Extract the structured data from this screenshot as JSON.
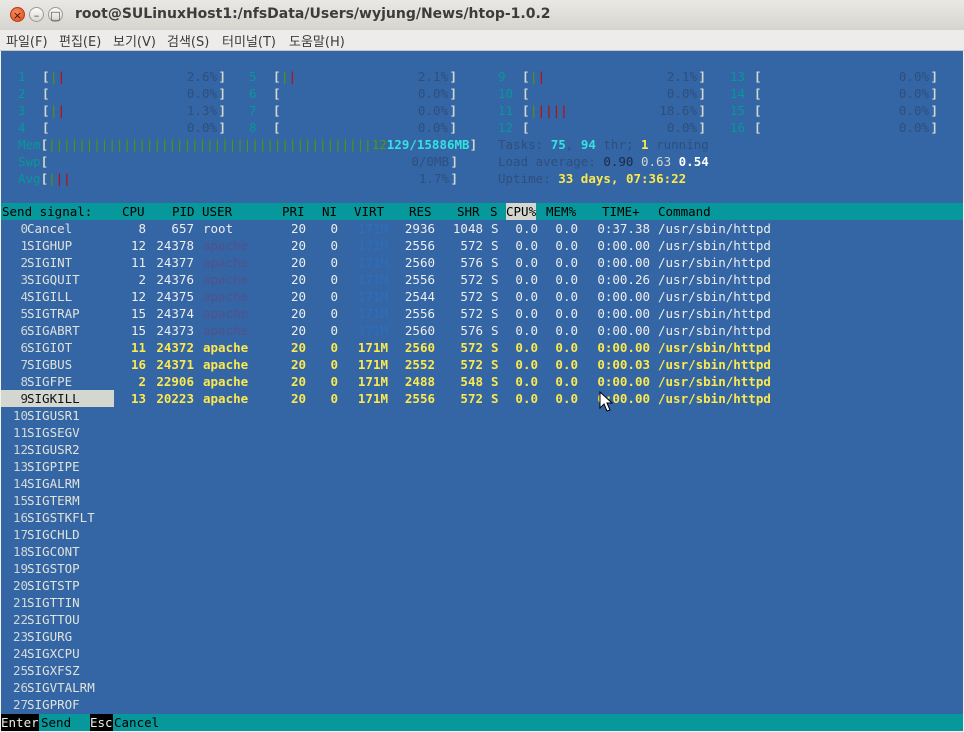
{
  "window": {
    "title": "root@SULinuxHost1:/nfsData/Users/wyjung/News/htop-1.0.2"
  },
  "menu": [
    "파일(F)",
    "편집(E)",
    "보기(V)",
    "검색(S)",
    "터미널(T)",
    "도움말(H)"
  ],
  "cpus": [
    {
      "id": "1",
      "bar": "||",
      "pct": "2.6%"
    },
    {
      "id": "2",
      "bar": "",
      "pct": "0.0%"
    },
    {
      "id": "3",
      "bar": "||",
      "pct": "1.3%"
    },
    {
      "id": "4",
      "bar": "",
      "pct": "0.0%"
    },
    {
      "id": "5",
      "bar": "||",
      "pct": "2.1%"
    },
    {
      "id": "6",
      "bar": "",
      "pct": "0.0%"
    },
    {
      "id": "7",
      "bar": "",
      "pct": "0.0%"
    },
    {
      "id": "8",
      "bar": "",
      "pct": "0.0%"
    },
    {
      "id": "9",
      "bar": "||",
      "pct": "2.1%"
    },
    {
      "id": "10",
      "bar": "",
      "pct": "0.0%"
    },
    {
      "id": "11",
      "bar": "|||||",
      "pct": "18.6%"
    },
    {
      "id": "12",
      "bar": "",
      "pct": "0.0%"
    },
    {
      "id": "13",
      "bar": "",
      "pct": "0.0%"
    },
    {
      "id": "14",
      "bar": "",
      "pct": "0.0%"
    },
    {
      "id": "15",
      "bar": "",
      "pct": "0.0%"
    },
    {
      "id": "16",
      "bar": "",
      "pct": "0.0%"
    }
  ],
  "meters": {
    "mem_label": "Mem",
    "mem_bar": "|||||||||||||||||||||||||||||||||||||||||||12",
    "mem_value": "129/15886MB",
    "swp_label": "Swp",
    "swp_value": "0/0MB",
    "avg_label": "Avg",
    "avg_value": "1.7%"
  },
  "tasks": {
    "label": "Tasks: ",
    "count": "75",
    "thr": "94",
    "thr_label": " thr; ",
    "running": "1",
    "running_label": " running",
    "load_label": "Load average: ",
    "load1": "0.90",
    "load5": "0.63",
    "load15": "0.54",
    "uptime_label": "Uptime: ",
    "days": "33",
    "days_label": " days",
    "time": "07:36:22"
  },
  "header": {
    "send_signal": "Send signal:",
    "cols": [
      "CPU",
      "PID",
      "USER",
      "PRI",
      "NI",
      "VIRT",
      "RES",
      "SHR",
      "S",
      "CPU%",
      "MEM%",
      "TIME+",
      "Command"
    ]
  },
  "signals": [
    {
      "n": "0",
      "name": "Cancel"
    },
    {
      "n": "1",
      "name": "SIGHUP"
    },
    {
      "n": "2",
      "name": "SIGINT"
    },
    {
      "n": "3",
      "name": "SIGQUIT"
    },
    {
      "n": "4",
      "name": "SIGILL"
    },
    {
      "n": "5",
      "name": "SIGTRAP"
    },
    {
      "n": "6",
      "name": "SIGABRT"
    },
    {
      "n": "6",
      "name": "SIGIOT"
    },
    {
      "n": "7",
      "name": "SIGBUS"
    },
    {
      "n": "8",
      "name": "SIGFPE"
    },
    {
      "n": "9",
      "name": "SIGKILL"
    },
    {
      "n": "10",
      "name": "SIGUSR1"
    },
    {
      "n": "11",
      "name": "SIGSEGV"
    },
    {
      "n": "12",
      "name": "SIGUSR2"
    },
    {
      "n": "13",
      "name": "SIGPIPE"
    },
    {
      "n": "14",
      "name": "SIGALRM"
    },
    {
      "n": "15",
      "name": "SIGTERM"
    },
    {
      "n": "16",
      "name": "SIGSTKFLT"
    },
    {
      "n": "17",
      "name": "SIGCHLD"
    },
    {
      "n": "18",
      "name": "SIGCONT"
    },
    {
      "n": "19",
      "name": "SIGSTOP"
    },
    {
      "n": "20",
      "name": "SIGTSTP"
    },
    {
      "n": "21",
      "name": "SIGTTIN"
    },
    {
      "n": "22",
      "name": "SIGTTOU"
    },
    {
      "n": "23",
      "name": "SIGURG"
    },
    {
      "n": "24",
      "name": "SIGXCPU"
    },
    {
      "n": "25",
      "name": "SIGXFSZ"
    },
    {
      "n": "26",
      "name": "SIGVTALRM"
    },
    {
      "n": "27",
      "name": "SIGPROF"
    }
  ],
  "selected_signal": "9",
  "processes": [
    {
      "cpu": "8",
      "pid": "657",
      "user": "root",
      "pri": "20",
      "ni": "0",
      "virt": "171M",
      "res": "2936",
      "shr": "1048",
      "s": "S",
      "cpup": "0.0",
      "memp": "0.0",
      "time": "0:37.38",
      "cmd": "/usr/sbin/httpd",
      "style": "normal"
    },
    {
      "cpu": "12",
      "pid": "24378",
      "user": "apache",
      "pri": "20",
      "ni": "0",
      "virt": "171M",
      "res": "2556",
      "shr": "572",
      "s": "S",
      "cpup": "0.0",
      "memp": "0.0",
      "time": "0:00.00",
      "cmd": "/usr/sbin/httpd",
      "style": "normal"
    },
    {
      "cpu": "11",
      "pid": "24377",
      "user": "apache",
      "pri": "20",
      "ni": "0",
      "virt": "171M",
      "res": "2560",
      "shr": "576",
      "s": "S",
      "cpup": "0.0",
      "memp": "0.0",
      "time": "0:00.00",
      "cmd": "/usr/sbin/httpd",
      "style": "normal"
    },
    {
      "cpu": "2",
      "pid": "24376",
      "user": "apache",
      "pri": "20",
      "ni": "0",
      "virt": "171M",
      "res": "2556",
      "shr": "572",
      "s": "S",
      "cpup": "0.0",
      "memp": "0.0",
      "time": "0:00.26",
      "cmd": "/usr/sbin/httpd",
      "style": "normal"
    },
    {
      "cpu": "12",
      "pid": "24375",
      "user": "apache",
      "pri": "20",
      "ni": "0",
      "virt": "171M",
      "res": "2544",
      "shr": "572",
      "s": "S",
      "cpup": "0.0",
      "memp": "0.0",
      "time": "0:00.00",
      "cmd": "/usr/sbin/httpd",
      "style": "normal"
    },
    {
      "cpu": "15",
      "pid": "24374",
      "user": "apache",
      "pri": "20",
      "ni": "0",
      "virt": "171M",
      "res": "2556",
      "shr": "572",
      "s": "S",
      "cpup": "0.0",
      "memp": "0.0",
      "time": "0:00.00",
      "cmd": "/usr/sbin/httpd",
      "style": "normal"
    },
    {
      "cpu": "15",
      "pid": "24373",
      "user": "apache",
      "pri": "20",
      "ni": "0",
      "virt": "171M",
      "res": "2560",
      "shr": "576",
      "s": "S",
      "cpup": "0.0",
      "memp": "0.0",
      "time": "0:00.00",
      "cmd": "/usr/sbin/httpd",
      "style": "normal"
    },
    {
      "cpu": "11",
      "pid": "24372",
      "user": "apache",
      "pri": "20",
      "ni": "0",
      "virt": "171M",
      "res": "2560",
      "shr": "572",
      "s": "S",
      "cpup": "0.0",
      "memp": "0.0",
      "time": "0:00.00",
      "cmd": "/usr/sbin/httpd",
      "style": "tagged"
    },
    {
      "cpu": "16",
      "pid": "24371",
      "user": "apache",
      "pri": "20",
      "ni": "0",
      "virt": "171M",
      "res": "2552",
      "shr": "572",
      "s": "S",
      "cpup": "0.0",
      "memp": "0.0",
      "time": "0:00.03",
      "cmd": "/usr/sbin/httpd",
      "style": "tagged"
    },
    {
      "cpu": "2",
      "pid": "22906",
      "user": "apache",
      "pri": "20",
      "ni": "0",
      "virt": "171M",
      "res": "2488",
      "shr": "548",
      "s": "S",
      "cpup": "0.0",
      "memp": "0.0",
      "time": "0:00.00",
      "cmd": "/usr/sbin/httpd",
      "style": "tagged"
    },
    {
      "cpu": "13",
      "pid": "20223",
      "user": "apache",
      "pri": "20",
      "ni": "0",
      "virt": "171M",
      "res": "2556",
      "shr": "572",
      "s": "S",
      "cpup": "0.0",
      "memp": "0.0",
      "time": "0:00.00",
      "cmd": "/usr/sbin/httpd",
      "style": "tagged"
    }
  ],
  "footer": {
    "key1": "Enter",
    "label1": "Send  ",
    "key2": "Esc",
    "label2": "Cancel"
  }
}
